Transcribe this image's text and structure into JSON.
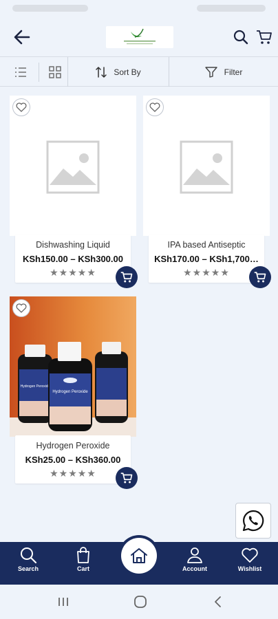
{
  "toolbar": {
    "sort_label": "Sort By",
    "filter_label": "Filter"
  },
  "products": [
    {
      "name": "Dishwashing Liquid",
      "price": "KSh150.00 – KSh300.00",
      "stars": "★★★★★",
      "image": "placeholder"
    },
    {
      "name": "IPA based Antiseptic",
      "price": "KSh170.00 – KSh1,700…",
      "stars": "★★★★★",
      "image": "placeholder"
    },
    {
      "name": "Hydrogen Peroxide",
      "price": "KSh25.00 – KSh360.00",
      "stars": "★★★★★",
      "image": "bottles-photo"
    }
  ],
  "bottom_nav": {
    "search": "Search",
    "cart": "Cart",
    "account": "Account",
    "wishlist": "Wishlist"
  },
  "colors": {
    "navy": "#1a2c5e",
    "background": "#eef3fa",
    "photo_background": "#e07a2e"
  }
}
